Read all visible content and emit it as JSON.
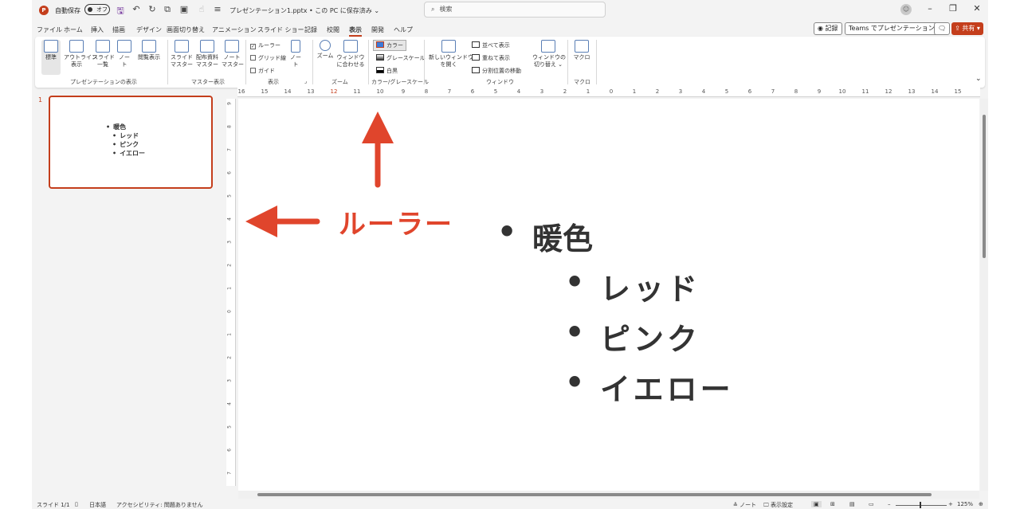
{
  "titlebar": {
    "autosave_label": "自動保存",
    "autosave_state": "オフ",
    "doc_title": "プレゼンテーション1.pptx • この PC に保存済み ⌄",
    "search_placeholder": "検索",
    "search_icon": "⌕",
    "undo_icon": "↶",
    "redo_icon": "↻",
    "save_icon": "🖫",
    "minimize_icon": "–",
    "restore_icon": "❐",
    "close_icon": "✕",
    "avatar_icon": "☺"
  },
  "tabs": [
    "ファイル",
    "ホーム",
    "挿入",
    "描画",
    "デザイン",
    "画面切り替え",
    "アニメーション",
    "スライド ショー",
    "記録",
    "校閲",
    "表示",
    "開発",
    "ヘルプ"
  ],
  "active_tab": "表示",
  "tab_buttons": {
    "record": "◉ 記録",
    "teams": "Teams でプレゼンテーション",
    "comment_icon": "🗨",
    "share": "⇪ 共有 ▾"
  },
  "ribbon": {
    "pres_views": [
      "標準",
      "アウトライン\n表示",
      "スライド\n一覧",
      "ノー\nト",
      "閲覧表示"
    ],
    "master_views": [
      "スライド\nマスター",
      "配布資料\nマスター",
      "ノート\nマスター"
    ],
    "show": {
      "ruler": "ルーラー",
      "grid": "グリッド線",
      "guide": "ガイド",
      "notes": "ノー\nト"
    },
    "zoom": [
      "ズーム",
      "ウィンドウ\nに合わせる"
    ],
    "color": [
      "カラー",
      "グレースケール",
      "白黒"
    ],
    "window": {
      "new_window": "新しいウィンドウ\nを開く",
      "arrange": "並べて表示",
      "cascade": "重ねて表示",
      "split": "分割位置の移動",
      "switch": "ウィンドウの\n切り替え ⌄"
    },
    "macro": "マクロ",
    "groups": [
      "プレゼンテーションの表示",
      "マスター表示",
      "表示",
      "ズーム",
      "カラー/グレースケール",
      "ウィンドウ",
      "マクロ"
    ],
    "collapse_icon": "⌄"
  },
  "thumbnail": {
    "number": "1",
    "items": [
      {
        "text": "暖色",
        "level": 1
      },
      {
        "text": "レッド",
        "level": 2
      },
      {
        "text": "ピンク",
        "level": 2
      },
      {
        "text": "イエロー",
        "level": 2
      }
    ]
  },
  "ruler_h_labels": [
    "16",
    "15",
    "14",
    "13",
    "12",
    "11",
    "10",
    "9",
    "8",
    "7",
    "6",
    "5",
    "4",
    "3",
    "2",
    "1",
    "0",
    "1",
    "2",
    "3",
    "4",
    "5",
    "6",
    "7",
    "8",
    "9",
    "10",
    "11",
    "12",
    "13",
    "14",
    "15"
  ],
  "ruler_v_labels": [
    "9",
    "8",
    "7",
    "6",
    "5",
    "4",
    "3",
    "2",
    "1",
    "0",
    "1",
    "2",
    "3",
    "4",
    "5",
    "6",
    "7"
  ],
  "slide": {
    "heading": "暖色",
    "items": [
      "レッド",
      "ピンク",
      "イエロー"
    ],
    "annotation": "ルーラー",
    "arrow_color": "#e0452c"
  },
  "statusbar": {
    "slide": "スライド 1/1",
    "language": "日本語",
    "accessibility": "アクセシビリティ: 問題ありません",
    "notes": "≙ ノート",
    "display_settings": "🖵 表示設定",
    "zoom": "125%"
  }
}
